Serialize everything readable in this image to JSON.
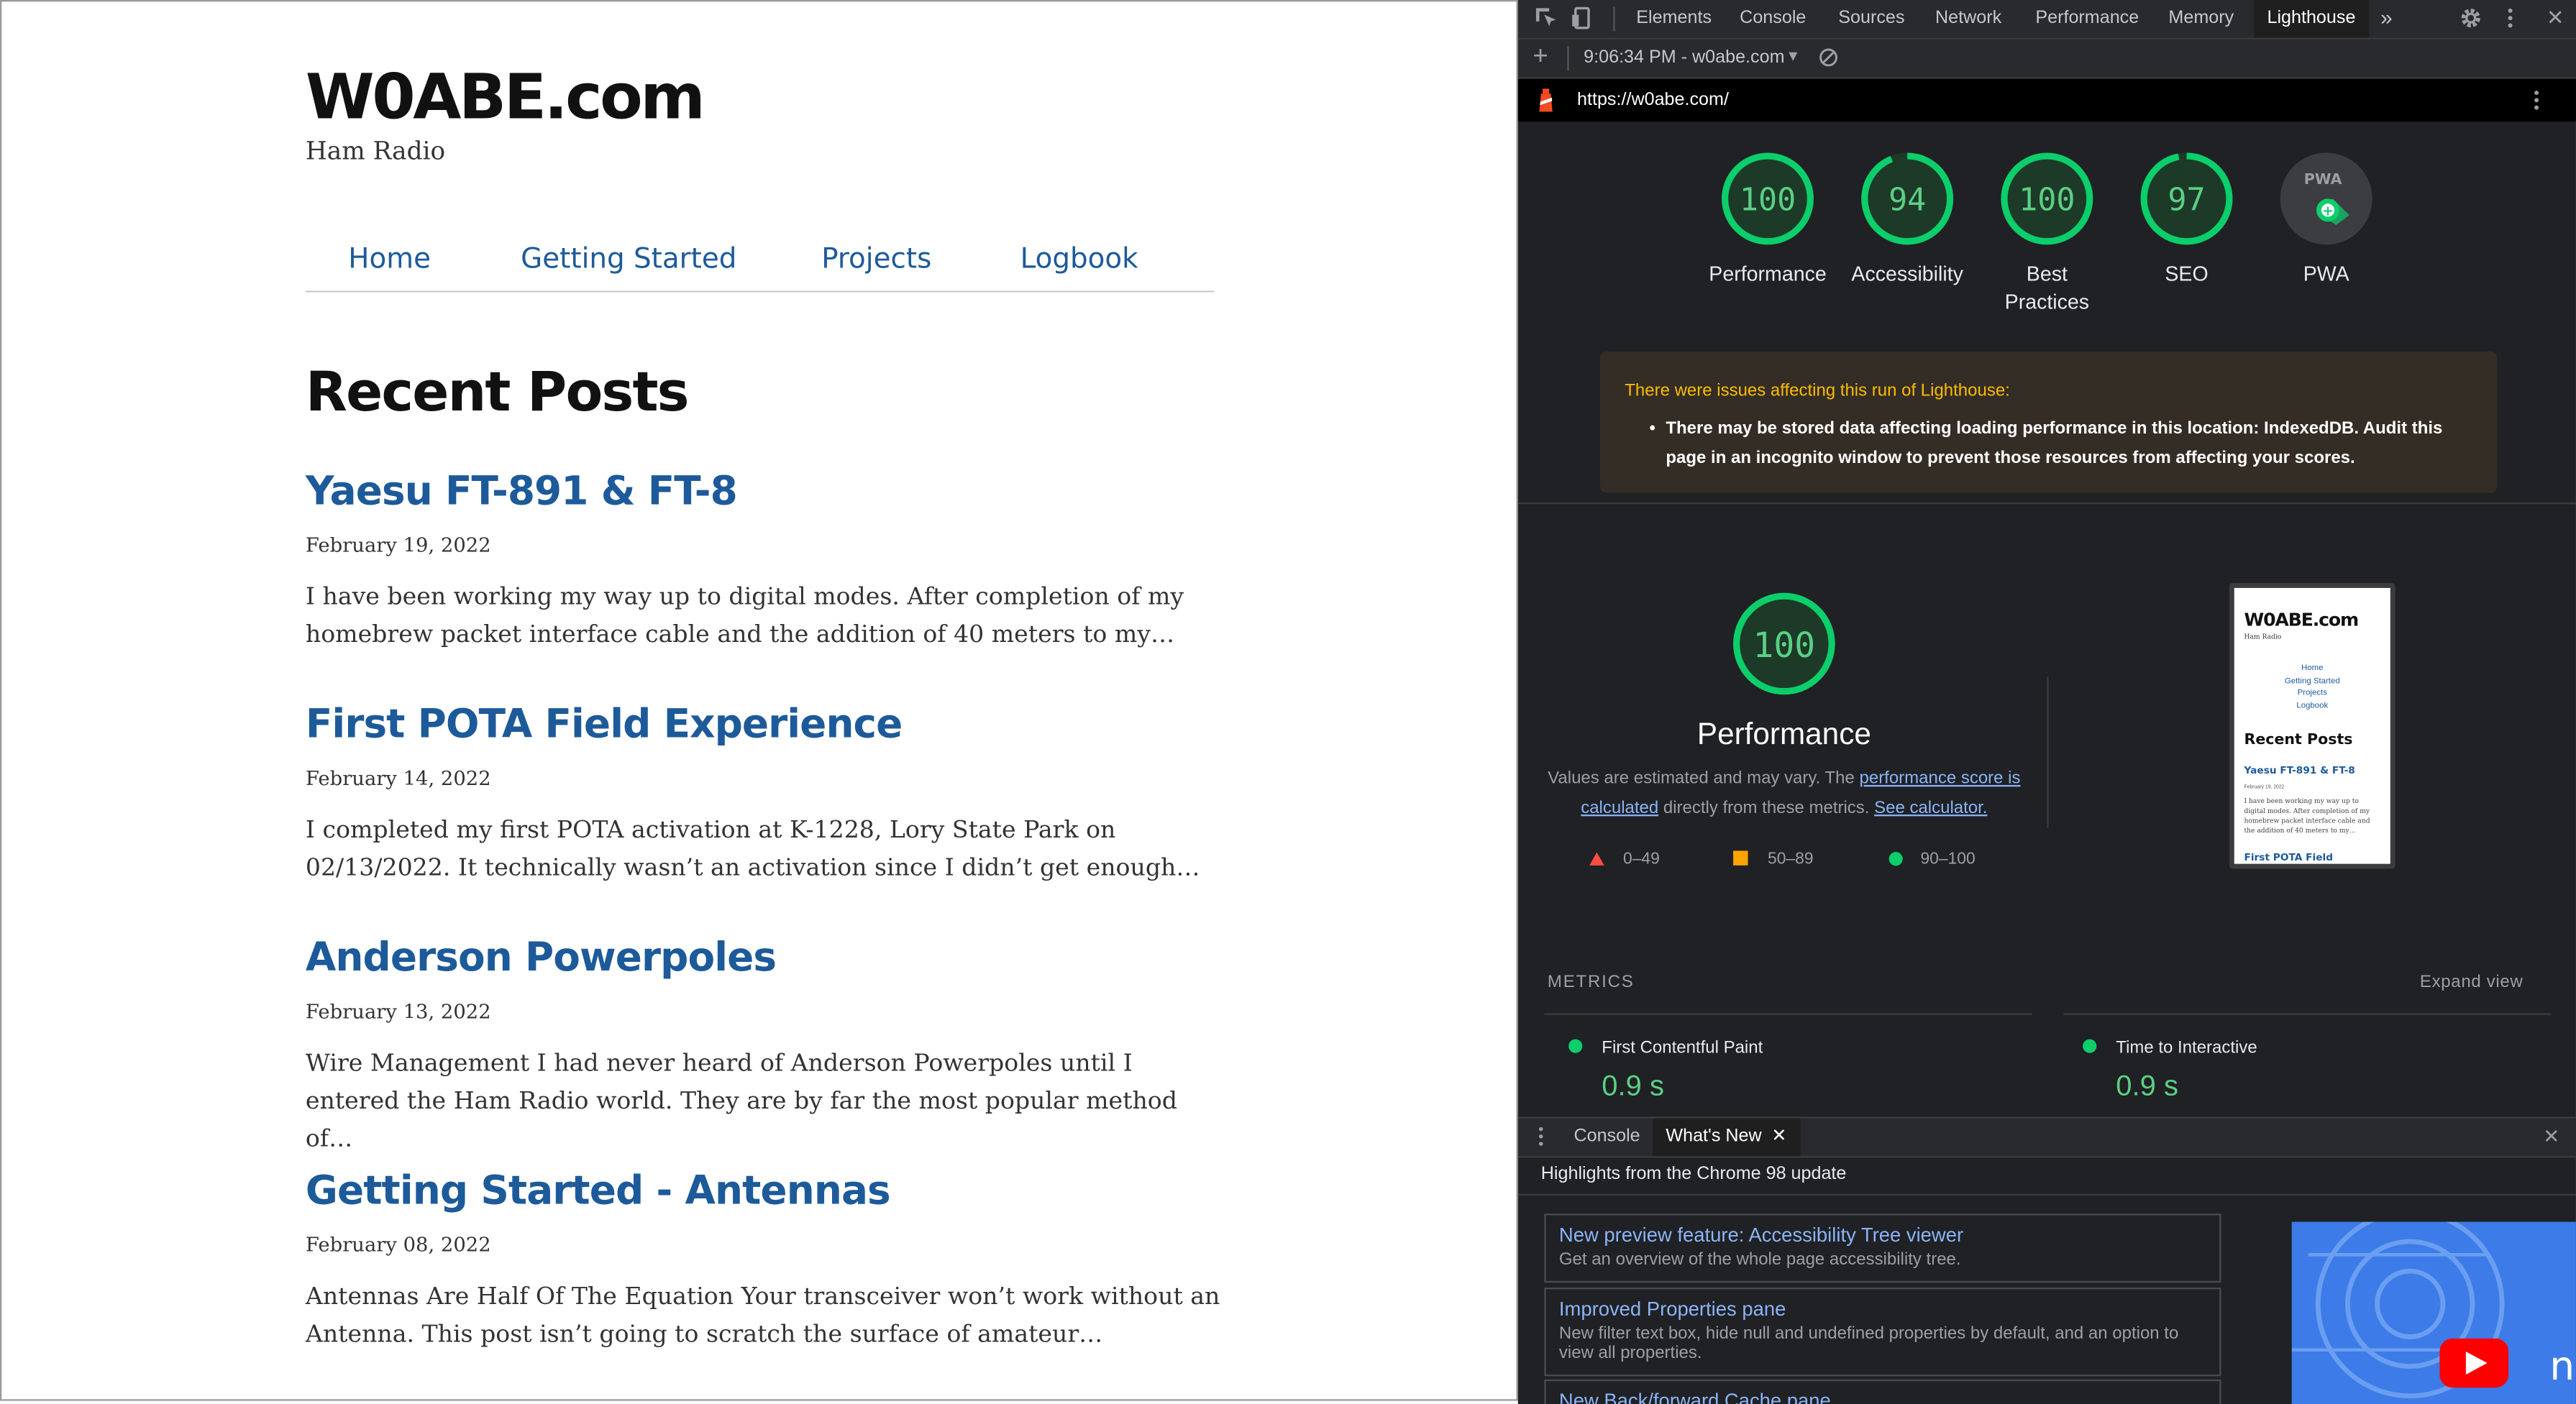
{
  "site": {
    "logo": "W0ABE.com",
    "tagline": "Ham Radio",
    "nav": [
      "Home",
      "Getting Started",
      "Projects",
      "Logbook"
    ],
    "heading": "Recent Posts",
    "posts": [
      {
        "title": "Yaesu FT-891 & FT-8",
        "date": "February 19, 2022",
        "excerpt": "I have been working my way up to digital modes. After completion of my homebrew packet interface cable and the addition of 40 meters to my…"
      },
      {
        "title": "First POTA Field Experience",
        "date": "February 14, 2022",
        "excerpt": "I completed my first POTA activation at K-1228, Lory State Park on 02/13/2022. It technically wasn’t an activation since I didn’t get enough…"
      },
      {
        "title": "Anderson Powerpoles",
        "date": "February 13, 2022",
        "excerpt": "Wire Management I had never heard of Anderson Powerpoles until I entered the Ham Radio world. They are by far the most popular method of…"
      },
      {
        "title": "Getting Started - Antennas",
        "date": "February 08, 2022",
        "excerpt": "Antennas Are Half Of The Equation Your transceiver won’t work without an Antenna. This post isn’t going to scratch the surface of amateur…"
      }
    ]
  },
  "devtools": {
    "tabs": [
      "Elements",
      "Console",
      "Sources",
      "Network",
      "Performance",
      "Memory",
      "Lighthouse"
    ],
    "active_tab": "Lighthouse",
    "more_tabs": "»",
    "run_label": "9:06:34 PM - w0abe.com",
    "url": "https://w0abe.com/",
    "scores": [
      {
        "label": "Performance",
        "value": "100",
        "fraction": 1.0
      },
      {
        "label": "Accessibility",
        "value": "94",
        "fraction": 0.94
      },
      {
        "label": "Best Practices",
        "value": "100",
        "fraction": 1.0
      },
      {
        "label": "SEO",
        "value": "97",
        "fraction": 0.97
      }
    ],
    "pwa_label": "PWA",
    "pwa_badge": "PWA",
    "warning_title": "There were issues affecting this run of Lighthouse:",
    "warning_body": "There may be stored data affecting loading performance in this location: IndexedDB. Audit this page in an incognito window to prevent those resources from affecting your scores.",
    "perf_score": "100",
    "perf_title": "Performance",
    "perf_note_pre": "Values are estimated and may vary. The ",
    "perf_note_link": "performance score is calculated",
    "perf_note_mid": " directly from these metrics. ",
    "perf_note_link2": "See calculator.",
    "legend": [
      "0–49",
      "50–89",
      "90–100"
    ],
    "metrics_heading": "METRICS",
    "expand_view": "Expand view",
    "metrics": [
      {
        "name": "First Contentful Paint",
        "value": "0.9 s"
      },
      {
        "name": "Time to Interactive",
        "value": "0.9 s"
      }
    ],
    "drawer_tabs": [
      "Console",
      "What's New"
    ],
    "highlights": "Highlights from the Chrome 98 update",
    "news": [
      {
        "title": "New preview feature: Accessibility Tree viewer",
        "desc": "Get an overview of the whole page accessibility tree."
      },
      {
        "title": "Improved Properties pane",
        "desc": "New filter text box, hide null and undefined properties by default, and an option to view all properties."
      },
      {
        "title": "New Back/forward Cache pane",
        "desc": ""
      }
    ],
    "thumb": {
      "logo": "W0ABE.com",
      "tagline": "Ham Radio",
      "nav": [
        "Home",
        "Getting Started",
        "Projects",
        "Logbook"
      ],
      "heading": "Recent Posts",
      "post": "Yaesu FT-891 & FT-8",
      "date": "February 19, 2022",
      "excerpt": "I have been working my way up to digital modes. After completion of my homebrew packet interface cable and the addition of 40 meters to my…",
      "next": "First POTA Field"
    },
    "colors": {
      "pass": "#0cce6b",
      "average": "#ffa400",
      "fail": "#ff4e42",
      "link": "#8ab4f8",
      "warn_text": "#fbbc04"
    }
  }
}
